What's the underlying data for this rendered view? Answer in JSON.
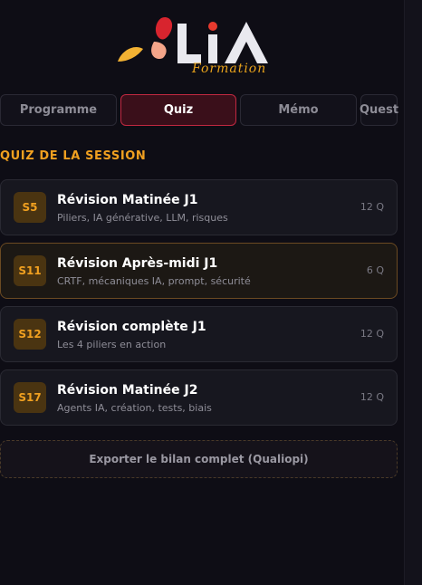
{
  "logo": {
    "brand": "ALiA",
    "sub": "Formation"
  },
  "tabs": [
    {
      "label": "Programme",
      "active": false
    },
    {
      "label": "Quiz",
      "active": true
    },
    {
      "label": "Mémo",
      "active": false
    },
    {
      "label": "Quest",
      "active": false
    }
  ],
  "section_title": "QUIZ DE LA SESSION",
  "quizzes": [
    {
      "badge": "S5",
      "title": "Révision Matinée J1",
      "subtitle": "Piliers, IA générative, LLM, risques",
      "count": "12 Q"
    },
    {
      "badge": "S11",
      "title": "Révision Après-midi J1",
      "subtitle": "CRTF, mécaniques IA, prompt, sécurité",
      "count": "6 Q"
    },
    {
      "badge": "S12",
      "title": "Révision complète J1",
      "subtitle": "Les 4 piliers en action",
      "count": "12 Q"
    },
    {
      "badge": "S17",
      "title": "Révision Matinée J2",
      "subtitle": "Agents IA, création, tests, biais",
      "count": "12 Q"
    }
  ],
  "export_label": "Exporter le bilan complet (Qualiopi)",
  "colors": {
    "accent": "#f0a020",
    "active_tab": "#c02840",
    "background": "#0e0d15"
  }
}
